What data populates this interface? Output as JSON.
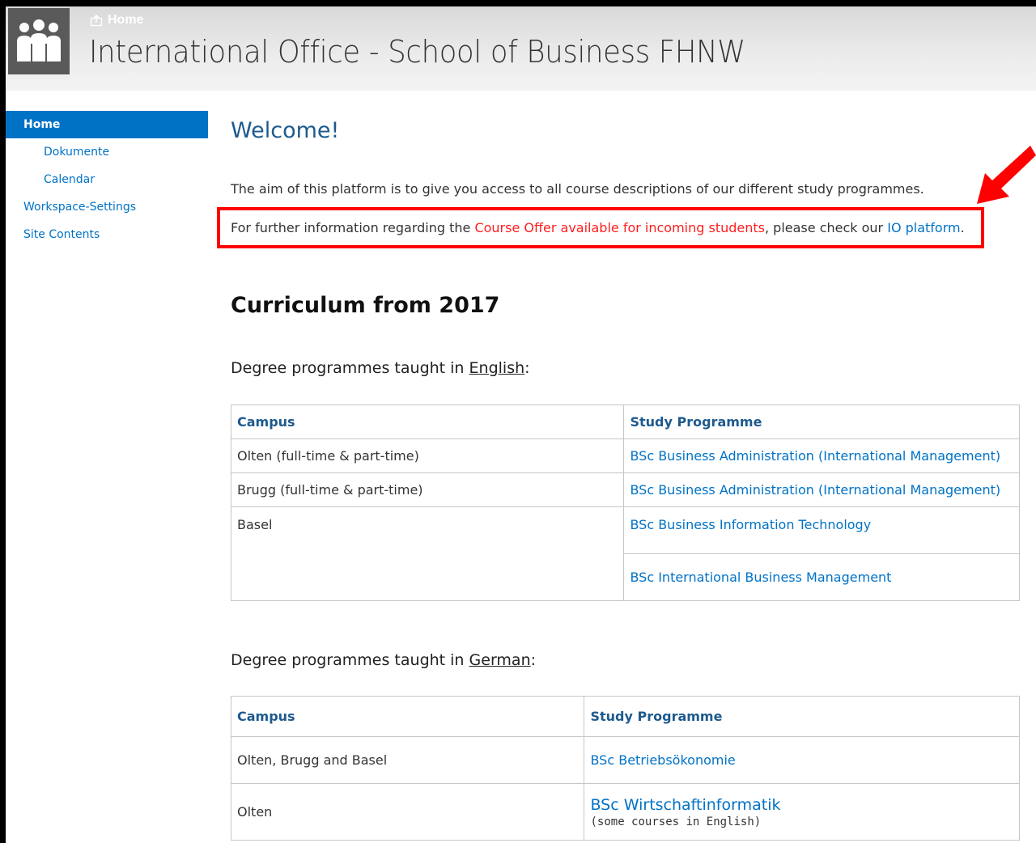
{
  "header": {
    "breadcrumb": "Home",
    "site_title": "International Office - School of Business FHNW"
  },
  "sidebar": {
    "items": [
      {
        "label": "Home"
      },
      {
        "label": "Dokumente"
      },
      {
        "label": "Calendar"
      },
      {
        "label": "Workspace-Settings"
      },
      {
        "label": "Site Contents"
      }
    ]
  },
  "main": {
    "welcome": "Welcome!",
    "intro": "The aim of this platform is to give you access to all course descriptions of our different study programmes.",
    "info": {
      "prefix": "For further information regarding the ",
      "course_offer_link": "Course Offer available for incoming students",
      "middle": ", please check our ",
      "io_link": "IO platform",
      "suffix": "."
    },
    "curriculum_heading": "Curriculum from 2017",
    "english": {
      "label_prefix": "Degree programmes taught in ",
      "language": "English",
      "label_suffix": ":",
      "headers": {
        "campus": "Campus",
        "programme": "Study Programme"
      },
      "rows": [
        {
          "campus": "Olten (full-time & part-time)",
          "programme": "BSc Business Administration (International Management)"
        },
        {
          "campus": "Brugg (full-time & part-time)",
          "programme": "BSc Business Administration (International Management)"
        },
        {
          "campus": "Basel",
          "programme": "BSc Business Information Technology"
        },
        {
          "campus": "",
          "programme": "BSc International Business Management"
        }
      ]
    },
    "german": {
      "label_prefix": "Degree programmes taught in ",
      "language": "German",
      "label_suffix": ":",
      "headers": {
        "campus": "Campus",
        "programme": "Study Programme"
      },
      "rows": [
        {
          "campus": "Olten, Brugg and Basel",
          "programme": "BSc Betriebsökonomie",
          "note": ""
        },
        {
          "campus": "Olten",
          "programme": "BSc Wirtschaftinformatik",
          "note": "(some courses in English)"
        }
      ]
    }
  },
  "colors": {
    "accent": "#0072c6",
    "highlight_border": "#ff0000",
    "arrow": "#ff0000",
    "heading_blue": "#1e5a8e"
  },
  "icons": {
    "logo": "people-group-icon",
    "breadcrumb": "share-icon",
    "annotation": "red-arrow-icon"
  }
}
